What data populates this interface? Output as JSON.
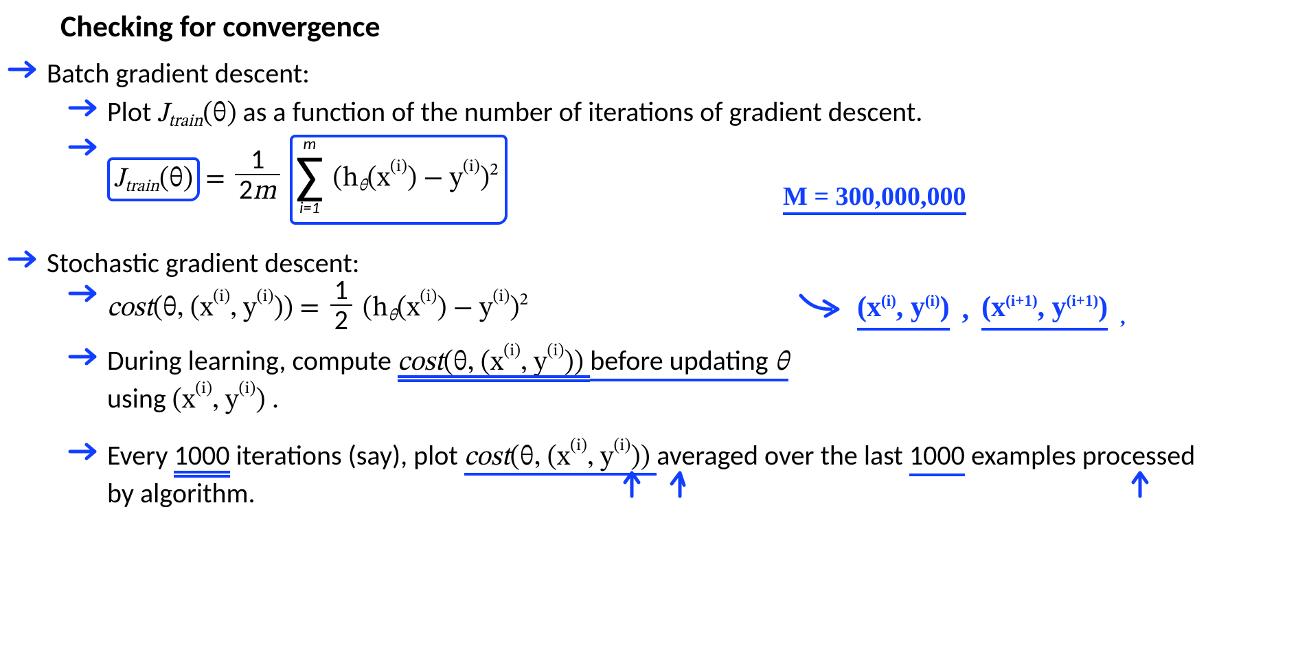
{
  "title": "Checking for convergence",
  "batch": {
    "heading": "Batch gradient descent:",
    "plot_pre": "Plot ",
    "jtrain_tex": "J",
    "jtrain_sub": "train",
    "jtrain_arg": "(θ)",
    "plot_post": " as a function of the number of iterations of gradient descent.",
    "eq_left_J": "J",
    "eq_left_sub": "train",
    "eq_left_arg": "(θ)",
    "eq_eq": "=",
    "frac_num": "1",
    "frac_den_pre": "2",
    "frac_den_var": "m",
    "sum_top": "m",
    "sum_bot": "i=1",
    "sum_body_pre": "(h",
    "sum_body_theta": "θ",
    "sum_body_x": "(x",
    "sum_sup_i": "(i)",
    "sum_body_minus": ") − y",
    "sum_body_close": ")",
    "sum_sq": "2"
  },
  "sgd": {
    "heading": "Stochastic gradient descent:",
    "cost_lhs_cost": "cost",
    "cost_lhs_args_open": "(θ, (x",
    "cost_sup_i": "(i)",
    "cost_lhs_mid": ", y",
    "cost_lhs_close": "))",
    "cost_eq": " = ",
    "half_num": "1",
    "half_den": "2",
    "cost_rhs_pre": "(h",
    "cost_rhs_theta": "θ",
    "cost_rhs_x": "(x",
    "cost_rhs_minus": ") − y",
    "cost_rhs_close": ")",
    "cost_sq": "2",
    "during_pre": "During learning, compute ",
    "during_mid": " before updating ",
    "during_theta": "θ",
    "during_using_pre": "using ",
    "during_using_open": "(x",
    "during_using_mid": ", y",
    "during_using_close": ")",
    "during_dot": " .",
    "every_pre": "Every ",
    "every_1000a": "1000",
    "every_mid1": " iterations (say), plot ",
    "every_mid2": " averaged over the last ",
    "every_1000b": "1000",
    "every_end": " examples processed by algorithm."
  },
  "ann": {
    "m_note": "M = 300,000,000",
    "pair_i_open": "(x",
    "pair_sup_i": "(i)",
    "pair_mid": ", y",
    "pair_close": ")",
    "pair_ip1_x": "(x",
    "pair_sup_ip1": "(i+1)",
    "pair_ip1_mid": ", y",
    "pair_ip1_close": ")",
    "comma": ","
  }
}
